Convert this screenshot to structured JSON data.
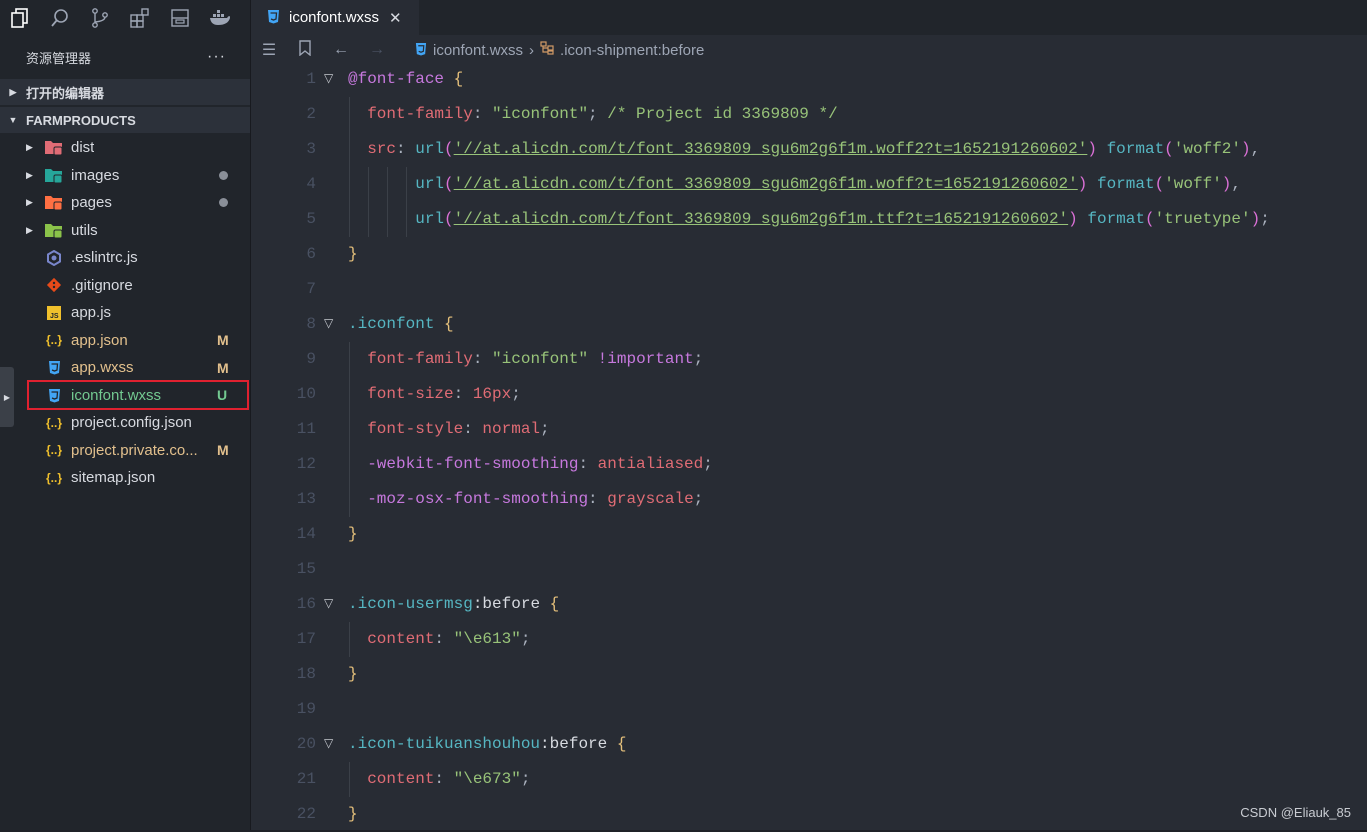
{
  "activity_bar": {
    "icons": [
      "files-icon",
      "search-icon",
      "source-control-icon",
      "extensions-icon",
      "outline-icon",
      "docker-icon"
    ]
  },
  "explorer": {
    "title": "资源管理器",
    "more": "···",
    "open_editors": "打开的编辑器",
    "project": "FARMPRODUCTS",
    "items": [
      {
        "name": "dist",
        "type": "folder",
        "color": "#e06c75",
        "badge": ""
      },
      {
        "name": "images",
        "type": "folder",
        "color": "#26a69a",
        "badge": "dot"
      },
      {
        "name": "pages",
        "type": "folder",
        "color": "#ff7043",
        "badge": "dot"
      },
      {
        "name": "utils",
        "type": "folder",
        "color": "#8bc34a",
        "badge": ""
      },
      {
        "name": ".eslintrc.js",
        "type": "eslint",
        "color": "#7986cb",
        "badge": ""
      },
      {
        "name": ".gitignore",
        "type": "git",
        "color": "#e64a19",
        "badge": ""
      },
      {
        "name": "app.js",
        "type": "js",
        "color": "#f0c02c",
        "badge": ""
      },
      {
        "name": "app.json",
        "type": "json",
        "color": "#f0c02c",
        "badge": "M"
      },
      {
        "name": "app.wxss",
        "type": "css",
        "color": "#42a5f5",
        "badge": "M"
      },
      {
        "name": "iconfont.wxss",
        "type": "css",
        "color": "#42a5f5",
        "badge": "U"
      },
      {
        "name": "project.config.json",
        "type": "json",
        "color": "#f0c02c",
        "badge": ""
      },
      {
        "name": "project.private.co...",
        "type": "json",
        "color": "#f0c02c",
        "badge": "M"
      },
      {
        "name": "sitemap.json",
        "type": "json",
        "color": "#f0c02c",
        "badge": ""
      }
    ]
  },
  "editor": {
    "tab_label": "iconfont.wxss",
    "tab_close": "✕",
    "breadcrumb_file": "iconfont.wxss",
    "breadcrumb_symbol": ".icon-shipment:before",
    "line_numbers": [
      "1",
      "2",
      "3",
      "4",
      "5",
      "6",
      "7",
      "8",
      "9",
      "10",
      "11",
      "12",
      "13",
      "14",
      "15",
      "16",
      "17",
      "18",
      "19",
      "20",
      "21",
      "22"
    ]
  },
  "watermark": "CSDN @Eliauk_85",
  "colors": {
    "accent_untracked": "#73c991",
    "accent_modified": "#e2c08d",
    "highlight_border": "#e02130"
  }
}
